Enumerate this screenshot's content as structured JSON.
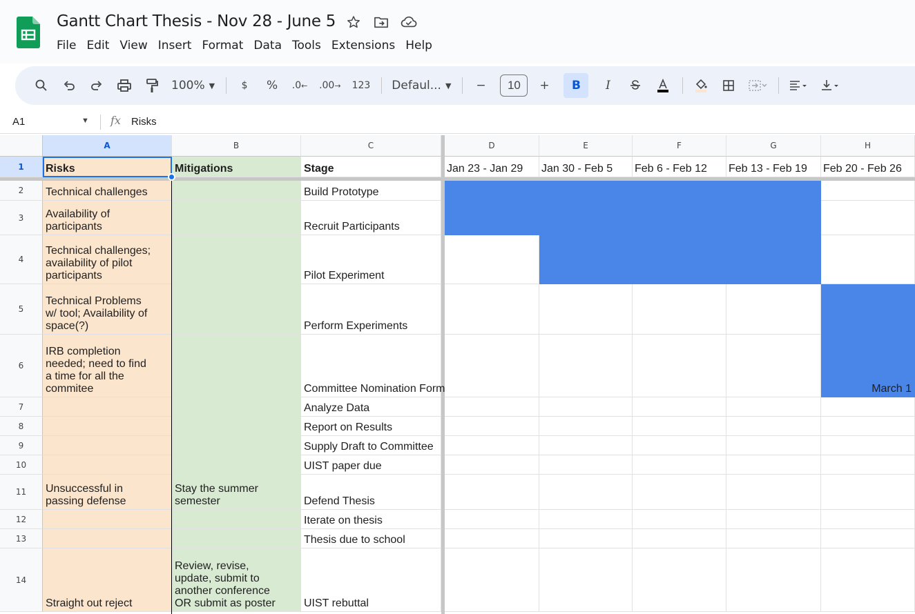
{
  "app": {
    "title": "Gantt Chart Thesis - Nov 28 - June 5",
    "brand_color": "#0f9d58",
    "menu": [
      "File",
      "Edit",
      "View",
      "Insert",
      "Format",
      "Data",
      "Tools",
      "Extensions",
      "Help"
    ]
  },
  "toolbar": {
    "zoom": "100%",
    "currency": "$",
    "percent": "%",
    "dec_decrease": ".0",
    "dec_increase": ".00",
    "more_formats": "123",
    "font": "Defaul...",
    "minus": "−",
    "font_size": "10",
    "plus": "+",
    "bold": "B",
    "italic": "I"
  },
  "formula_bar": {
    "name_box": "A1",
    "fx": "fx",
    "value": "Risks"
  },
  "columns": [
    "A",
    "B",
    "C",
    "D",
    "E",
    "F",
    "G",
    "H"
  ],
  "rows": [
    {
      "n": "1",
      "risk": "Risks",
      "mit": "Mitigations",
      "stage": "Stage",
      "weeks": [
        "Jan 23 - Jan 29",
        "Jan 30 - Feb 5",
        "Feb 6 - Feb 12",
        "Feb 13 - Feb 19",
        "Feb 20 - Feb 26"
      ]
    },
    {
      "n": "2",
      "risk": "Technical challenges",
      "mit": "",
      "stage": "Build Prototype",
      "bars": [
        1,
        1,
        1,
        1,
        0
      ]
    },
    {
      "n": "3",
      "risk": "Availability of\nparticipants",
      "mit": "",
      "stage": "Recruit Participants",
      "bars": [
        1,
        1,
        1,
        1,
        0
      ]
    },
    {
      "n": "4",
      "risk": "Technical challenges;\navailability of pilot\nparticipants",
      "mit": "",
      "stage": "Pilot Experiment",
      "bars": [
        0,
        1,
        1,
        1,
        0
      ]
    },
    {
      "n": "5",
      "risk": "Technical Problems\nw/ tool; Availability of\nspace(?)",
      "mit": "",
      "stage": "Perform Experiments",
      "bars": [
        0,
        0,
        0,
        0,
        1
      ]
    },
    {
      "n": "6",
      "risk": "IRB completion\nneeded; need to find\na time for all the\ncommitee",
      "mit": "",
      "stage": "Committee Nomination Form",
      "bars": [
        0,
        0,
        0,
        0,
        1
      ],
      "h_text": "March 1"
    },
    {
      "n": "7",
      "risk": "",
      "mit": "",
      "stage": "Analyze Data"
    },
    {
      "n": "8",
      "risk": "",
      "mit": "",
      "stage": "Report on Results"
    },
    {
      "n": "9",
      "risk": "",
      "mit": "",
      "stage": "Supply Draft to Committee"
    },
    {
      "n": "10",
      "risk": "",
      "mit": "",
      "stage": "UIST paper due"
    },
    {
      "n": "11",
      "risk": "Unsuccessful in\npassing defense",
      "mit": "Stay the summer\nsemester",
      "stage": "Defend Thesis"
    },
    {
      "n": "12",
      "risk": "",
      "mit": "",
      "stage": "Iterate on thesis"
    },
    {
      "n": "13",
      "risk": "",
      "mit": "",
      "stage": "Thesis due to school"
    },
    {
      "n": "14",
      "risk": "Straight out reject",
      "mit": "Review, revise,\nupdate, submit to\nanother conference\nOR submit as poster",
      "stage": "UIST rebuttal"
    }
  ],
  "colors": {
    "risk_fill": "#fce5cd",
    "mitigation_fill": "#d9ead3",
    "gantt_bar": "#4a86e8",
    "selection": "#1a73e8"
  }
}
